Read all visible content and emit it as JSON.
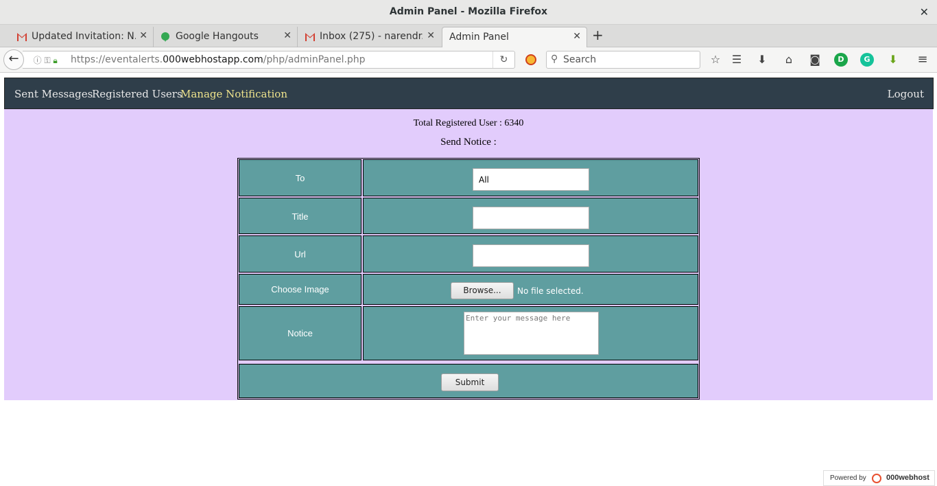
{
  "window": {
    "title": "Admin Panel - Mozilla Firefox",
    "close": "✕"
  },
  "tabs": [
    {
      "label": "Updated Invitation: N...",
      "icon": "gmail-icon"
    },
    {
      "label": "Google Hangouts",
      "icon": "hangouts-icon"
    },
    {
      "label": "Inbox (275) - narendr...",
      "icon": "gmail-icon"
    },
    {
      "label": "Admin Panel",
      "icon": "none"
    }
  ],
  "toolbar": {
    "url_prefix": "https://eventalerts.",
    "url_domain": "000webhostapp.com",
    "url_path": "/php/adminPanel.php",
    "search_placeholder": "Search"
  },
  "site_nav": {
    "items": [
      "Sent Messages",
      "Registered Users",
      "Manage Notification"
    ],
    "active": "Manage Notification",
    "logout": "Logout"
  },
  "content": {
    "total_registered": "Total Registered User : 6340",
    "send_notice": "Send Notice :"
  },
  "form": {
    "to_label": "To",
    "to_value": "All",
    "title_label": "Title",
    "title_value": "",
    "url_label": "Url",
    "url_value": "",
    "image_label": "Choose Image",
    "browse_label": "Browse...",
    "no_file": "No file selected.",
    "notice_label": "Notice",
    "notice_placeholder": "Enter your message here",
    "submit_label": "Submit"
  },
  "footer": {
    "powered_by": "Powered by",
    "brand": "000webhost"
  },
  "colors": {
    "nav_bg": "#2f3e4a",
    "active_link": "#eee38c",
    "content_bg": "#e2ccfc",
    "cell_bg": "#5f9ea0"
  }
}
